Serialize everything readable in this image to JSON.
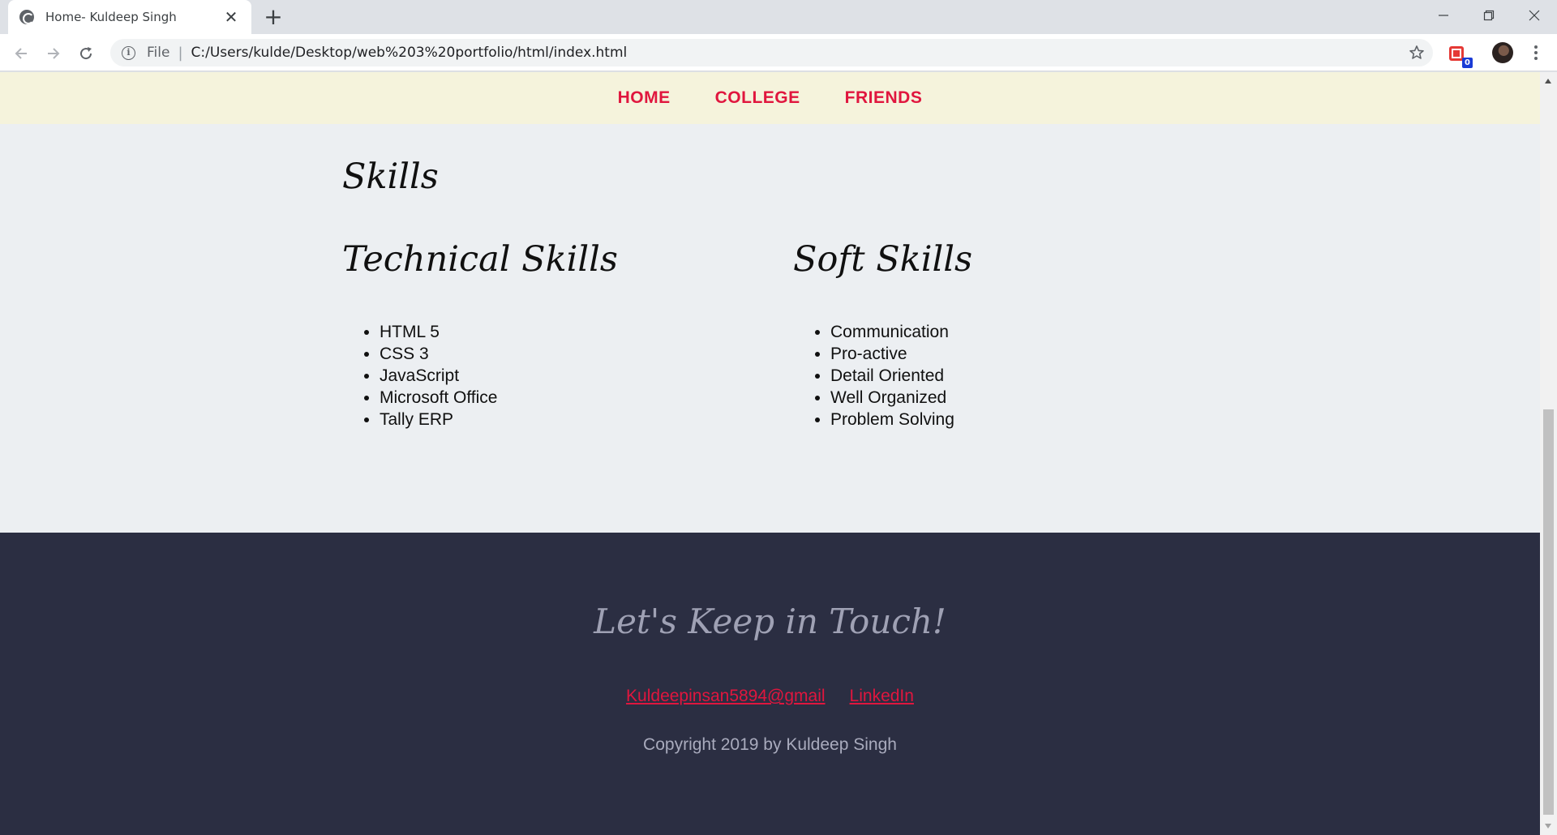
{
  "browser": {
    "tab_title": "Home- Kuldeep Singh",
    "scheme_label": "File",
    "url": "C:/Users/kulde/Desktop/web%203%20portfolio/html/index.html",
    "extension_badge": "0"
  },
  "nav": {
    "home": "HOME",
    "college": "COLLEGE",
    "friends": "FRIENDS"
  },
  "skills": {
    "title": "Skills",
    "technical": {
      "title": "Technical Skills",
      "items": [
        "HTML 5",
        "CSS 3",
        "JavaScript",
        "Microsoft Office",
        "Tally ERP"
      ]
    },
    "soft": {
      "title": "Soft Skills",
      "items": [
        "Communication",
        "Pro-active",
        "Detail Oriented",
        "Well Organized",
        "Problem Solving"
      ]
    }
  },
  "footer": {
    "title": "Let's Keep in Touch!",
    "email_link": "Kuldeepinsan5894@gmail",
    "linkedin_link": "LinkedIn",
    "copyright": "Copyright 2019 by Kuldeep Singh"
  },
  "colors": {
    "nav_background": "#f5f3dc",
    "accent_red": "#e0163e",
    "page_background": "#eceff2",
    "footer_background": "#2b2e42"
  }
}
